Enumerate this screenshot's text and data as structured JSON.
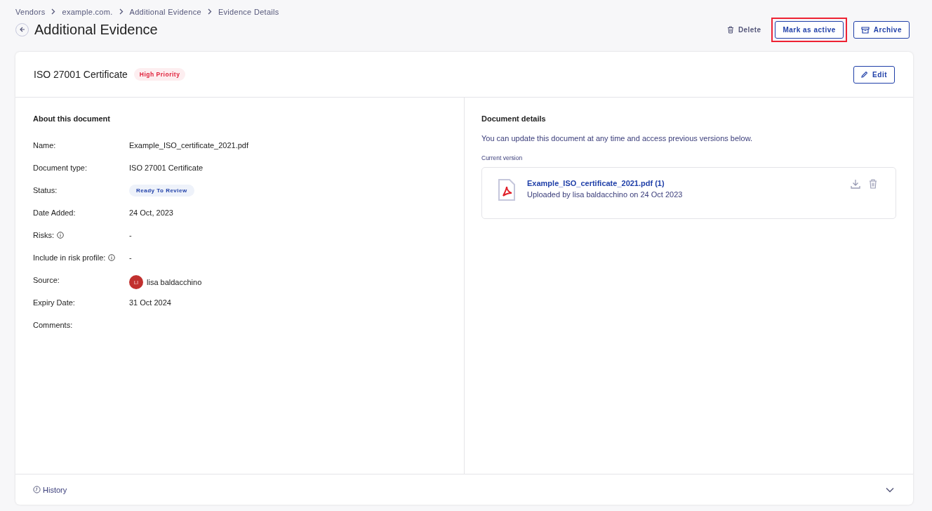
{
  "breadcrumbs": [
    "Vendors",
    "example.com.",
    "Additional Evidence",
    "Evidence Details"
  ],
  "page_title": "Additional Evidence",
  "actions": [
    {
      "kind": "link",
      "label": "Delete",
      "highlighted": false
    },
    {
      "kind": "outline",
      "label": "Mark as active",
      "highlighted": true
    },
    {
      "kind": "archive",
      "label": "Archive",
      "highlighted": false
    }
  ],
  "card": {
    "title": "ISO 27001 Certificate",
    "priority": "High Priority",
    "edit_label": "Edit"
  },
  "about": {
    "heading": "About this document",
    "rows": [
      {
        "label": "Name:",
        "kind": "text",
        "value": "Example_ISO_certificate_2021.pdf",
        "info": false
      },
      {
        "label": "Document type:",
        "kind": "text",
        "value": "ISO 27001 Certificate",
        "info": false
      },
      {
        "label": "Status:",
        "kind": "badge",
        "value": "Ready To Review",
        "info": false
      },
      {
        "label": "Date Added:",
        "kind": "text",
        "value": "24 Oct, 2023",
        "info": false
      },
      {
        "label": "Risks:",
        "kind": "text",
        "value": "-",
        "info": true
      },
      {
        "label": "Include in risk profile:",
        "kind": "text",
        "value": "-",
        "info": true
      },
      {
        "label": "Source:",
        "kind": "person",
        "value": "lisa baldacchino",
        "initials": "LI",
        "info": false
      },
      {
        "label": "Expiry Date:",
        "kind": "text",
        "value": "31 Oct 2024",
        "info": false
      },
      {
        "label": "Comments:",
        "kind": "text",
        "value": "",
        "info": false
      }
    ]
  },
  "details": {
    "heading": "Document details",
    "description": "You can update this document at any time and access previous versions below.",
    "version_label": "Current version",
    "file": {
      "name": "Example_ISO_certificate_2021.pdf (1)",
      "uploaded": "Uploaded by lisa baldacchino on 24 Oct 2023"
    }
  },
  "footer": {
    "label": "History",
    "expanded": false
  }
}
